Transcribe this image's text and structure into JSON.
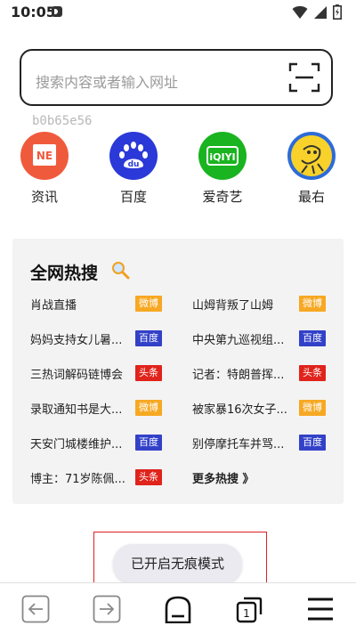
{
  "status_bar": {
    "time": "10:05"
  },
  "search": {
    "placeholder": "搜索内容或者输入网址"
  },
  "hash_text": "b0b65e56",
  "quick_links": [
    {
      "label": "资讯",
      "icon": "news-icon",
      "color": "#f05a3c"
    },
    {
      "label": "百度",
      "icon": "baidu-icon",
      "color": "#2b39d8"
    },
    {
      "label": "爱奇艺",
      "icon": "iqiyi-icon",
      "color": "#19b420"
    },
    {
      "label": "最右",
      "icon": "zuiyou-icon",
      "color": "#f8d22a"
    }
  ],
  "hot_search": {
    "title": "全网热搜",
    "items": [
      {
        "text": "肖战直播",
        "badge": "微博"
      },
      {
        "text": "山姆背叛了山姆",
        "badge": "微博"
      },
      {
        "text": "妈妈支持女儿暑...",
        "badge": "百度"
      },
      {
        "text": "中央第九巡视组...",
        "badge": "百度"
      },
      {
        "text": "三热词解码链博会",
        "badge": "头条"
      },
      {
        "text": "记者：特朗普挥...",
        "badge": "头条"
      },
      {
        "text": "录取通知书是大...",
        "badge": "微博"
      },
      {
        "text": "被家暴16次女子...",
        "badge": "微博"
      },
      {
        "text": "天安门城楼维护...",
        "badge": "百度"
      },
      {
        "text": "别停摩托车并骂...",
        "badge": "百度"
      },
      {
        "text": "博主：71岁陈佩...",
        "badge": "头条"
      }
    ],
    "more_label": "更多热搜 》",
    "badge_colors": {
      "微博": "#f7a823",
      "百度": "#3241c8",
      "头条": "#e0231b"
    }
  },
  "toast": {
    "text": "已开启无痕模式"
  },
  "bottom_nav": {
    "back_icon": "back-icon",
    "forward_icon": "forward-icon",
    "home_icon": "home-icon",
    "tabs_count": "1",
    "menu_icon": "menu-icon"
  }
}
